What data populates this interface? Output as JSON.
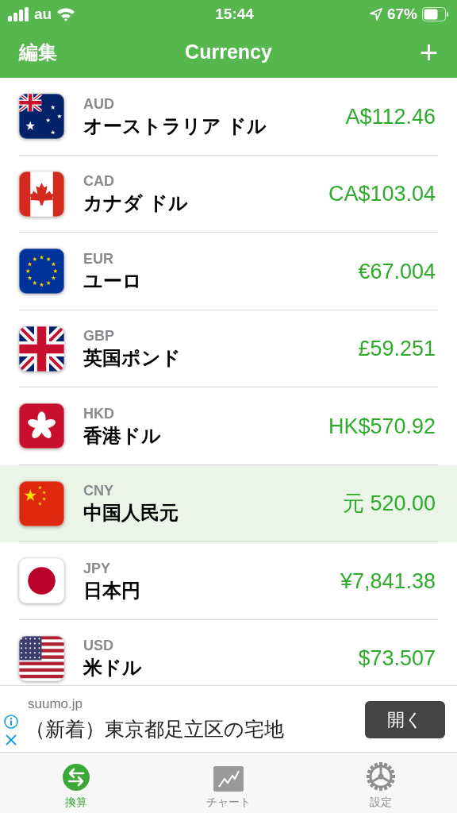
{
  "status_bar": {
    "carrier": "au",
    "time": "15:44",
    "battery_percent": "67%"
  },
  "nav_bar": {
    "left_button": "編集",
    "title": "Currency",
    "right_button": "+"
  },
  "currencies": [
    {
      "code": "AUD",
      "name": "オーストラリア ドル",
      "amount": "A$112.46",
      "selected": false
    },
    {
      "code": "CAD",
      "name": "カナダ ドル",
      "amount": "CA$103.04",
      "selected": false
    },
    {
      "code": "EUR",
      "name": "ユーロ",
      "amount": "€67.004",
      "selected": false
    },
    {
      "code": "GBP",
      "name": "英国ポンド",
      "amount": "£59.251",
      "selected": false
    },
    {
      "code": "HKD",
      "name": "香港ドル",
      "amount": "HK$570.92",
      "selected": false
    },
    {
      "code": "CNY",
      "name": "中国人民元",
      "amount": "元 520.00",
      "selected": true
    },
    {
      "code": "JPY",
      "name": "日本円",
      "amount": "¥7,841.38",
      "selected": false
    },
    {
      "code": "USD",
      "name": "米ドル",
      "amount": "$73.507",
      "selected": false
    }
  ],
  "ad": {
    "domain": "suumo.jp",
    "headline": "（新着）東京都足立区の宅地",
    "button": "開く"
  },
  "tab_bar": [
    {
      "label": "換算",
      "selected": true
    },
    {
      "label": "チャート",
      "selected": false
    },
    {
      "label": "設定",
      "selected": false
    }
  ]
}
